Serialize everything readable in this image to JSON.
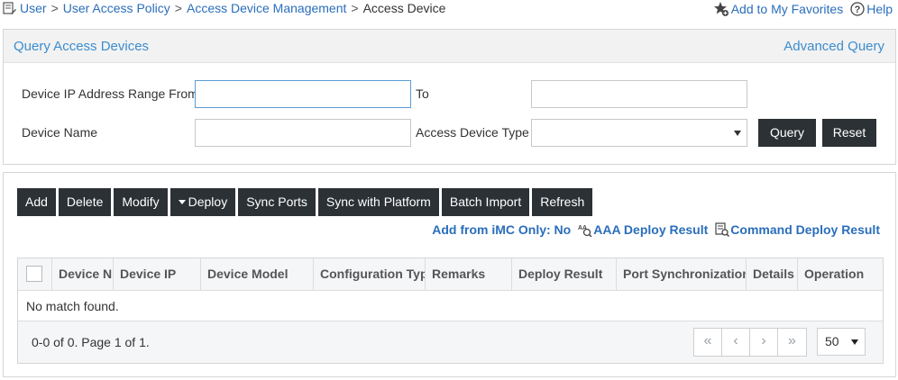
{
  "breadcrumb": {
    "items": [
      "User",
      "User Access Policy",
      "Access Device Management"
    ],
    "separator": ">",
    "current": "Access Device"
  },
  "top_right": {
    "favorites": "Add to My Favorites",
    "help": "Help"
  },
  "query": {
    "title": "Query Access Devices",
    "advanced": "Advanced Query",
    "ip_from_label": "Device IP Address Range From",
    "ip_from_value": "",
    "to_label": "To",
    "ip_to_value": "",
    "name_label": "Device Name",
    "name_value": "",
    "type_label": "Access Device Type",
    "type_value": "",
    "query_button": "Query",
    "reset_button": "Reset"
  },
  "toolbar": {
    "add": "Add",
    "delete": "Delete",
    "modify": "Modify",
    "deploy": "Deploy",
    "sync_ports": "Sync Ports",
    "sync_platform": "Sync with Platform",
    "batch_import": "Batch Import",
    "refresh": "Refresh"
  },
  "links": {
    "add_from_imc": "Add from iMC Only: No",
    "aaa_deploy": "AAA Deploy Result",
    "command_deploy": "Command Deploy Result"
  },
  "table": {
    "columns": [
      "Device N",
      "Device IP",
      "Device Model",
      "Configuration Typ",
      "Remarks",
      "Deploy Result",
      "Port Synchronization",
      "Details",
      "Operation"
    ],
    "empty_message": "No match found."
  },
  "pagination": {
    "info": "0-0 of 0. Page 1 of 1.",
    "first": "«",
    "prev": "‹",
    "next": "›",
    "last": "»",
    "page_size": "50"
  },
  "colors": {
    "link": "#2a6ebb",
    "panel_title": "#3c8dcf",
    "dark_button": "#2c3135"
  }
}
